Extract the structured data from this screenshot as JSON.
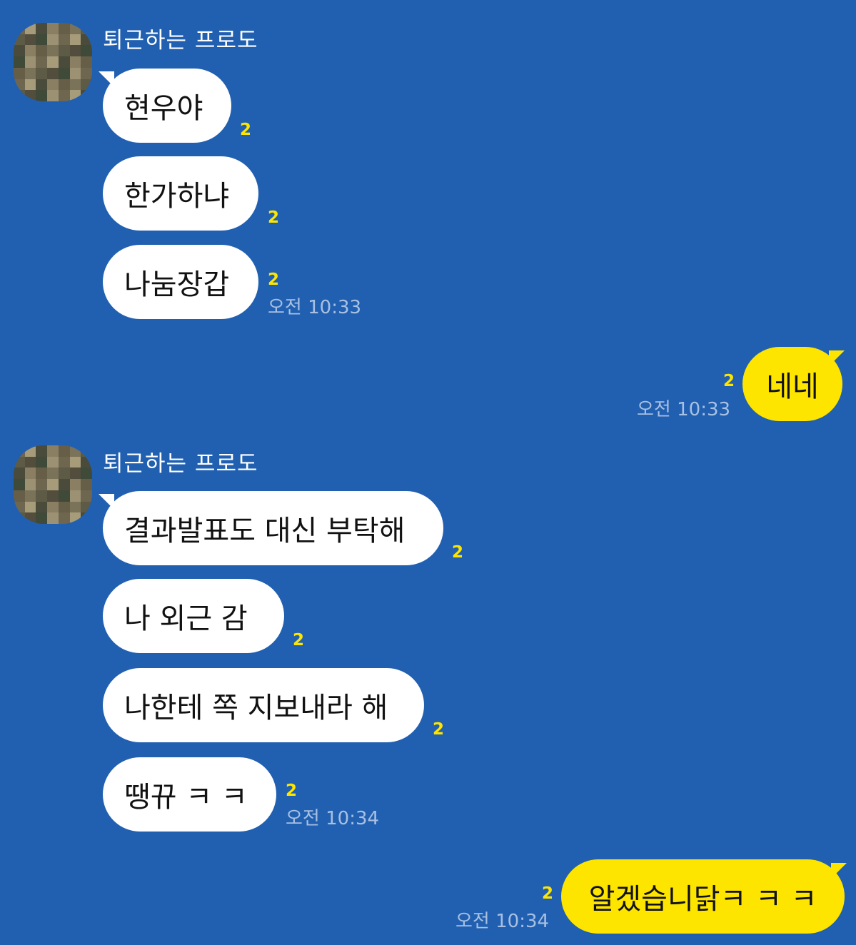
{
  "groups": [
    {
      "sender": "퇴근하는 프로도",
      "messages": [
        {
          "text": "현우야",
          "unread": "2"
        },
        {
          "text": "한가하냐",
          "unread": "2"
        },
        {
          "text": "나눔장갑",
          "unread": "2",
          "time": "오전 10:33"
        }
      ]
    },
    {
      "sender": "퇴근하는 프로도",
      "messages": [
        {
          "text": "결과발표도 대신 부탁해",
          "unread": "2"
        },
        {
          "text": "나 외근 감",
          "unread": "2"
        },
        {
          "text": "나한테 쪽 지보내라 해",
          "unread": "2"
        },
        {
          "text": "땡뀨 ㅋ ㅋ",
          "unread": "2",
          "time": "오전 10:34"
        }
      ]
    }
  ],
  "my_messages": [
    {
      "text": "네네",
      "unread": "2",
      "time": "오전 10:33"
    },
    {
      "text": "알겠습니닭ㅋ ㅋ ㅋ",
      "unread": "2",
      "time": "오전 10:34"
    }
  ],
  "colors": {
    "background": "#2160b1",
    "my_bubble": "#fee500",
    "their_bubble": "#ffffff",
    "unread_count": "#fee500",
    "timestamp": "#a8c0e2"
  }
}
